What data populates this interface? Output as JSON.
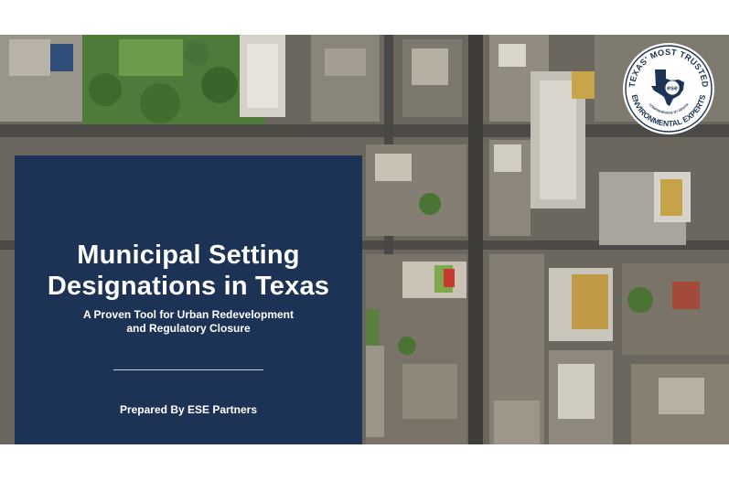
{
  "slide": {
    "title_line1": "Municipal Setting",
    "title_line2": "Designations in Texas",
    "subtitle_line1": "A Proven Tool for Urban Redevelopment",
    "subtitle_line2": "and Regulatory Closure",
    "prepared_by": "Prepared By ESE Partners"
  },
  "badge": {
    "top_text": "TEXAS' MOST TRUSTED",
    "bottom_text": "ENVIRONMENTAL EXPERTS",
    "tagline": "COMPREHENSIVE BY DESIGN",
    "logo_text": "ese"
  },
  "colors": {
    "panel": "#1c3355",
    "badge_ring": "#1c3355"
  }
}
